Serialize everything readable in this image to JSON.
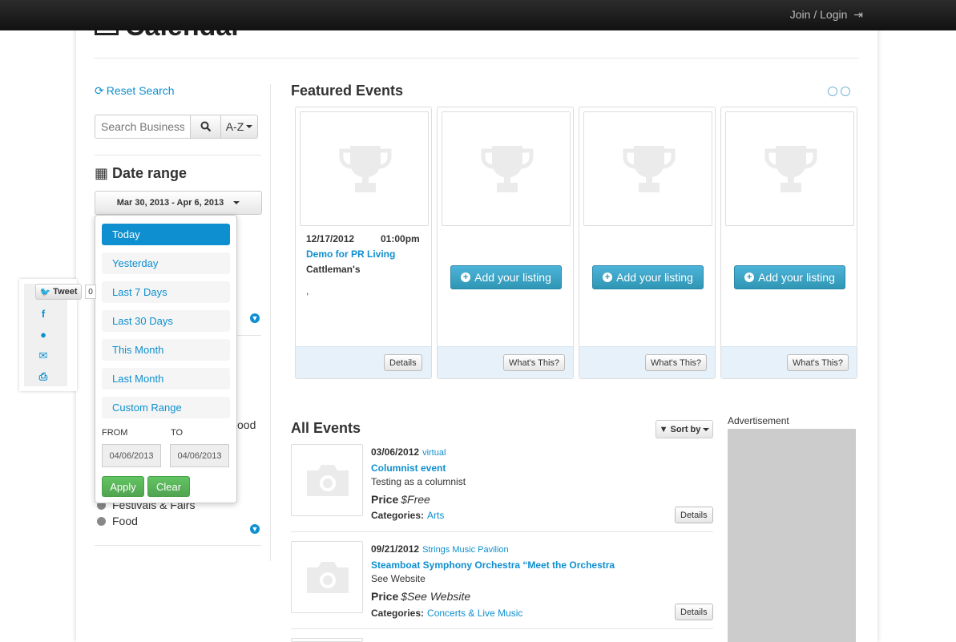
{
  "header": {
    "login_label": "Join / Login"
  },
  "page": {
    "title": "Calendar"
  },
  "sidebar": {
    "reset_label": "Reset Search",
    "search_placeholder": "Search Business",
    "sort_label": "A-Z",
    "date_range_title": "Date range",
    "date_range_value": "Mar 30, 2013 - Apr 6, 2013",
    "partial_item": "ood",
    "categories": [
      "Festivals & Fairs",
      "Food"
    ]
  },
  "date_dropdown": {
    "options": [
      "Today",
      "Yesterday",
      "Last 7 Days",
      "Last 30 Days",
      "This Month",
      "Last Month",
      "Custom Range"
    ],
    "active_option": "Today",
    "from_label": "FROM",
    "to_label": "TO",
    "from_value": "04/06/2013",
    "to_value": "04/06/2013",
    "apply_label": "Apply",
    "clear_label": "Clear"
  },
  "share": {
    "tweet_label": "Tweet",
    "tweet_count": "0"
  },
  "featured": {
    "title": "Featured Events",
    "first_event": {
      "date": "12/17/2012",
      "time": "01:00pm",
      "title": "Demo for PR Living",
      "venue": "Cattleman's",
      "address": ",",
      "details_label": "Details"
    },
    "add_listing_label": "Add your listing",
    "whats_this_label": "What's This?"
  },
  "all_events": {
    "title": "All Events",
    "sort_label": "Sort by",
    "rows": [
      {
        "date": "03/06/2012",
        "venue": "virtual",
        "title": "Columnist event",
        "description": "Testing as a columnist",
        "price_label": "Price",
        "price": "$Free",
        "categories_label": "Categories:",
        "categories": "Arts",
        "details_label": "Details"
      },
      {
        "date": "09/21/2012",
        "venue": "Strings Music Pavilion",
        "title": "Steamboat Symphony Orchestra “Meet the Orchestra",
        "description": "See Website",
        "price_label": "Price",
        "price": "$See Website",
        "categories_label": "Categories:",
        "categories": "Concerts & Live Music",
        "details_label": "Details"
      }
    ]
  },
  "ad": {
    "label": "Advertisement"
  },
  "colors": {
    "accent": "#0e8fcf",
    "header_bg": "#1a1a1a",
    "success": "#51a351",
    "info": "#2f96b4"
  }
}
